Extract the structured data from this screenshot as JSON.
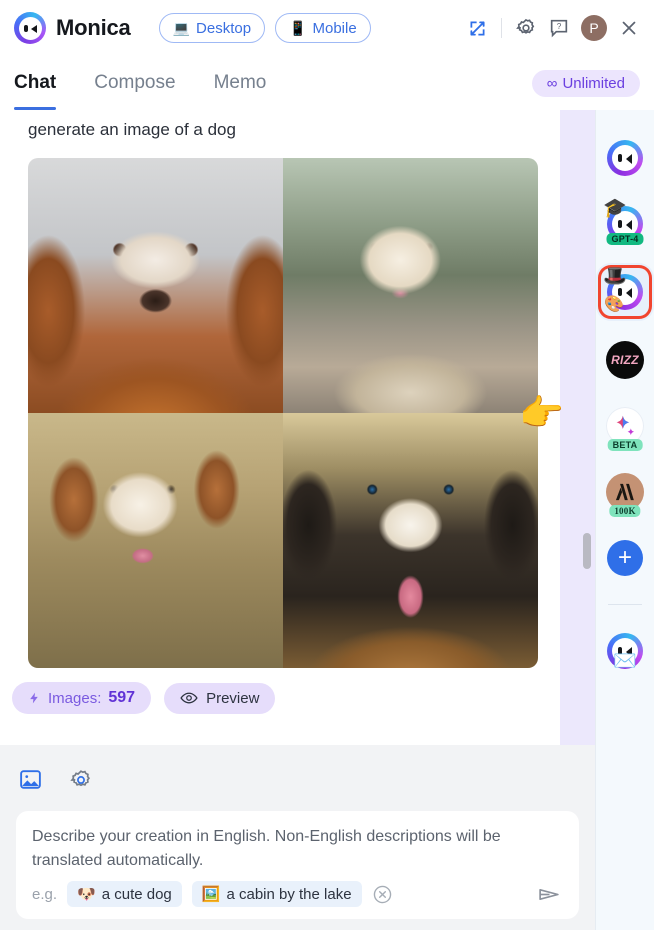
{
  "header": {
    "brand": "Monica",
    "logo_icon": "monica-logo-icon",
    "device_buttons": [
      {
        "label": "Desktop",
        "emoji": "💻",
        "icon": "laptop-icon"
      },
      {
        "label": "Mobile",
        "emoji": "📱",
        "icon": "phone-icon"
      }
    ],
    "actions": [
      {
        "name": "expand-icon"
      },
      {
        "name": "settings-gear-icon"
      },
      {
        "name": "help-icon"
      }
    ],
    "avatar_letter": "P",
    "close_label": "×"
  },
  "tabs": {
    "items": [
      {
        "label": "Chat",
        "active": true
      },
      {
        "label": "Compose",
        "active": false
      },
      {
        "label": "Memo",
        "active": false
      }
    ],
    "badge": {
      "label": "Unlimited",
      "symbol": "∞",
      "color": "#6b3fe0"
    }
  },
  "chat": {
    "message": "generate an image of a dog",
    "images": [
      {
        "alt": "brown and white collie portrait"
      },
      {
        "alt": "fluffy cream dog lying on forest path"
      },
      {
        "alt": "white and tan dog in dry grass"
      },
      {
        "alt": "tricolor bernese-type dog close up"
      }
    ],
    "pointer_emoji": "👉",
    "badges": {
      "images_label": "Images:",
      "images_count": "597",
      "bolt_icon": "bolt-icon",
      "preview_label": "Preview",
      "eye_icon": "eye-icon"
    }
  },
  "sidebar": {
    "items": [
      {
        "name": "monica-default",
        "kind": "monica",
        "tag": ""
      },
      {
        "name": "monica-gpt4",
        "kind": "monica-cap",
        "tag": "GPT-4"
      },
      {
        "name": "monica-artist",
        "kind": "monica-artist",
        "tag": "",
        "selected": true
      },
      {
        "name": "rizz-bot",
        "kind": "rizz",
        "label": "RIZZ",
        "tag": ""
      },
      {
        "name": "gemini-bot",
        "kind": "gemini",
        "emoji": "✨",
        "tag": "BETA"
      },
      {
        "name": "claude-bot",
        "kind": "claude",
        "label": "A\\",
        "tag": "100K"
      },
      {
        "name": "add-bot",
        "kind": "plus",
        "label": "+"
      },
      {
        "name": "monica-mail",
        "kind": "monica-mail",
        "emoji": "✉️",
        "tag": ""
      }
    ]
  },
  "composer": {
    "tools": [
      {
        "name": "image-mode-icon",
        "active": true
      },
      {
        "name": "settings-gear-icon",
        "active": false
      }
    ],
    "placeholder": "Describe your creation in English. Non-English descriptions will be translated automatically.",
    "eg_label": "e.g.",
    "examples": [
      {
        "emoji": "🐶",
        "label": "a cute dog"
      },
      {
        "emoji": "🖼️",
        "label": "a cabin by the lake"
      }
    ],
    "clear_icon": "clear-circle-icon",
    "send_icon": "send-icon"
  },
  "colors": {
    "accent_blue": "#3b6fe0",
    "accent_purple": "#6b3fe0",
    "purple_strip": "#ece8fc",
    "selected_red": "#f1452f",
    "sidebar_bg": "#f4f9fd"
  }
}
